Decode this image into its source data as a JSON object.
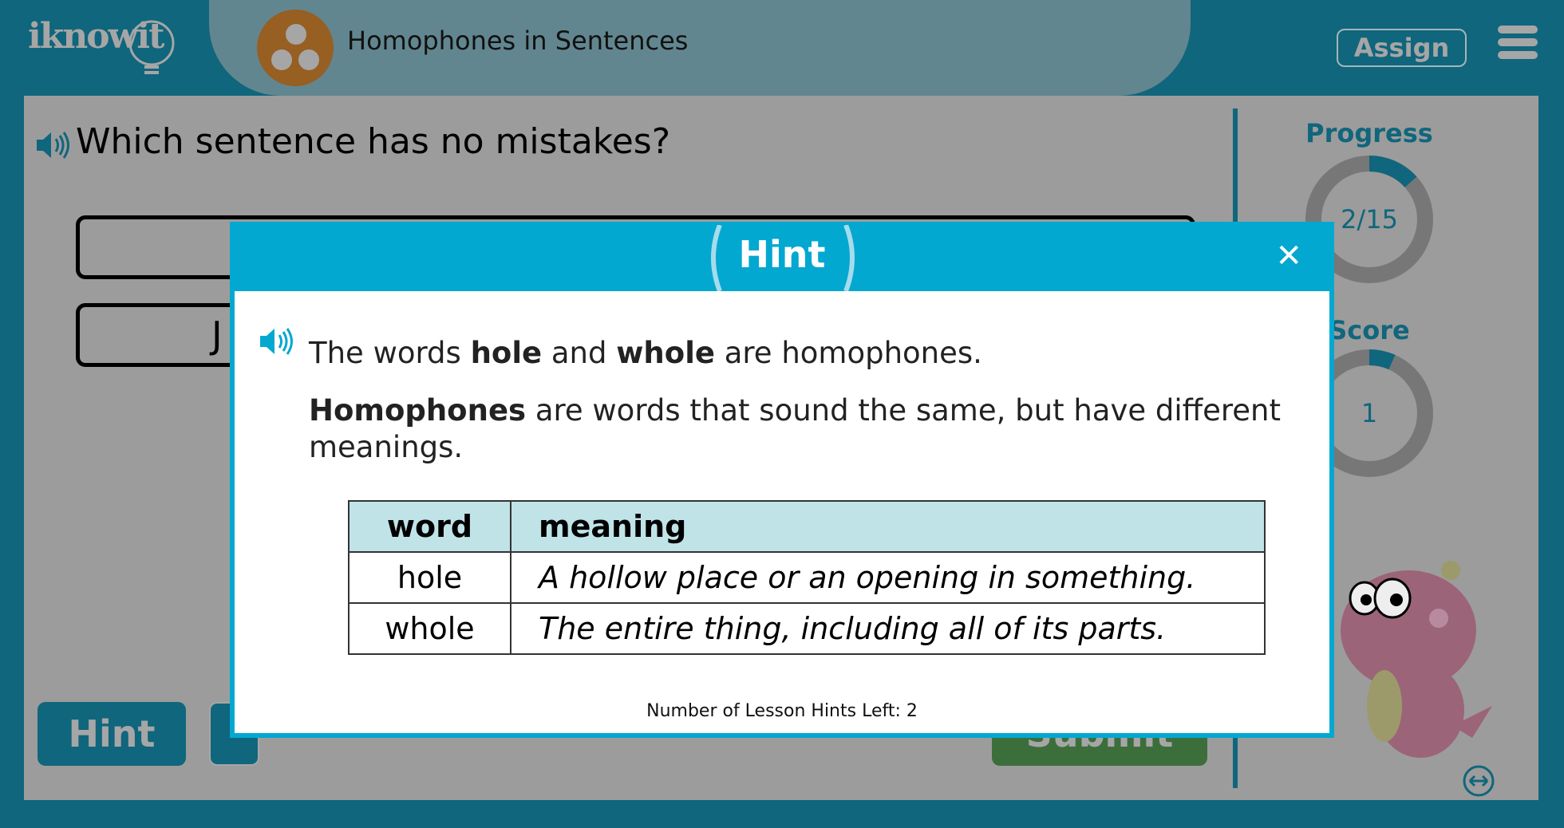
{
  "header": {
    "logo": "iknowit",
    "lesson_title": "Homophones in Sentences",
    "assign_label": "Assign"
  },
  "question": {
    "text": "Which sentence has no mistakes?",
    "option2_partial": "J"
  },
  "sidebar": {
    "progress_label": "Progress",
    "progress_value": "2/15",
    "progress_fraction": 0.1333,
    "score_label": "Score",
    "score_value": "1",
    "score_fraction": 0.0667
  },
  "footer": {
    "hint_label": "Hint",
    "submit_label": "Submit"
  },
  "modal": {
    "title": "Hint",
    "line1": {
      "a": "The words ",
      "b": "hole",
      "c": " and ",
      "d": "whole",
      "e": " are homophones."
    },
    "line2": {
      "a": "Homophones",
      "b": " are words that sound the same, but have different meanings."
    },
    "table": {
      "headers": [
        "word",
        "meaning"
      ],
      "rows": [
        [
          "hole",
          "A hollow place or an opening in something."
        ],
        [
          "whole",
          "The entire thing, including all of its parts."
        ]
      ]
    },
    "hints_left": "Number of Lesson Hints Left: 2"
  },
  "colors": {
    "header": "#10667c",
    "modal_accent": "#03a8d0",
    "table_header": "#c0e3e8",
    "submit": "#3c6e3c"
  }
}
